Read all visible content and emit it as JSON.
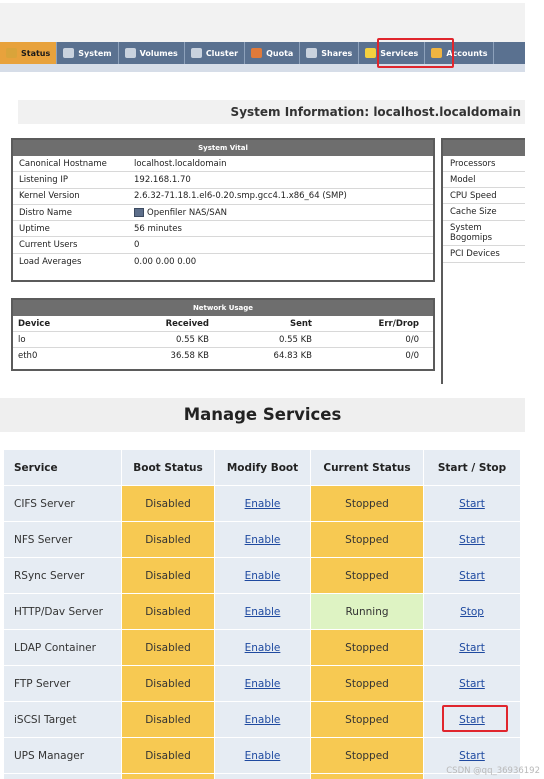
{
  "nav": {
    "tabs": [
      {
        "label": "Status",
        "icon": "status-icon",
        "color": "#d9a43a"
      },
      {
        "label": "System",
        "icon": "system-icon",
        "color": "#c9d2de"
      },
      {
        "label": "Volumes",
        "icon": "volumes-icon",
        "color": "#c9d2de"
      },
      {
        "label": "Cluster",
        "icon": "cluster-icon",
        "color": "#c9d2de"
      },
      {
        "label": "Quota",
        "icon": "quota-icon",
        "color": "#e07a3a"
      },
      {
        "label": "Shares",
        "icon": "shares-icon",
        "color": "#c9d2de"
      },
      {
        "label": "Services",
        "icon": "services-icon",
        "color": "#f4d03f"
      },
      {
        "label": "Accounts",
        "icon": "accounts-icon",
        "color": "#f0b441"
      }
    ],
    "active_tab": "Status",
    "highlighted_tab": "Services"
  },
  "system_info": {
    "heading": "System Information: localhost.localdomain"
  },
  "system_vital": {
    "title": "System Vital",
    "rows": [
      {
        "label": "Canonical Hostname",
        "value": "localhost.localdomain"
      },
      {
        "label": "Listening IP",
        "value": "192.168.1.70"
      },
      {
        "label": "Kernel Version",
        "value": "2.6.32-71.18.1.el6-0.20.smp.gcc4.1.x86_64 (SMP)"
      },
      {
        "label": "Distro Name",
        "value": "Openfiler NAS/SAN",
        "icon": "distro-icon"
      },
      {
        "label": "Uptime",
        "value": "56 minutes"
      },
      {
        "label": "Current Users",
        "value": "0"
      },
      {
        "label": "Load Averages",
        "value": "0.00 0.00 0.00"
      }
    ]
  },
  "hardware": {
    "labels": [
      "Processors",
      "Model",
      "CPU Speed",
      "Cache Size",
      "System\nBogomips",
      "PCI Devices"
    ]
  },
  "network_usage": {
    "title": "Network Usage",
    "headers": [
      "Device",
      "Received",
      "Sent",
      "Err/Drop"
    ],
    "rows": [
      [
        "lo",
        "0.55 KB",
        "0.55 KB",
        "0/0"
      ],
      [
        "eth0",
        "36.58 KB",
        "64.83 KB",
        "0/0"
      ]
    ]
  },
  "manage_services": {
    "title": "Manage Services",
    "headers": [
      "Service",
      "Boot Status",
      "Modify Boot",
      "Current Status",
      "Start / Stop"
    ],
    "rows": [
      {
        "service": "CIFS Server",
        "boot": "Disabled",
        "modify": "Enable",
        "current": "Stopped",
        "action": "Start"
      },
      {
        "service": "NFS Server",
        "boot": "Disabled",
        "modify": "Enable",
        "current": "Stopped",
        "action": "Start"
      },
      {
        "service": "RSync Server",
        "boot": "Disabled",
        "modify": "Enable",
        "current": "Stopped",
        "action": "Start"
      },
      {
        "service": "HTTP/Dav Server",
        "boot": "Disabled",
        "modify": "Enable",
        "current": "Running",
        "action": "Stop"
      },
      {
        "service": "LDAP Container",
        "boot": "Disabled",
        "modify": "Enable",
        "current": "Stopped",
        "action": "Start"
      },
      {
        "service": "FTP Server",
        "boot": "Disabled",
        "modify": "Enable",
        "current": "Stopped",
        "action": "Start"
      },
      {
        "service": "iSCSI Target",
        "boot": "Disabled",
        "modify": "Enable",
        "current": "Stopped",
        "action": "Start"
      },
      {
        "service": "UPS Manager",
        "boot": "Disabled",
        "modify": "Enable",
        "current": "Stopped",
        "action": "Start"
      }
    ],
    "highlighted_service": "iSCSI Target"
  },
  "watermark": "CSDN @qq_36936192",
  "colors": {
    "tab_bar": "#5a7190",
    "active_tab": "#e8a23c",
    "highlight": "#e0262d",
    "disabled_cell": "#f7c952",
    "running_cell": "#def3c3",
    "link": "#1f4aa0"
  }
}
